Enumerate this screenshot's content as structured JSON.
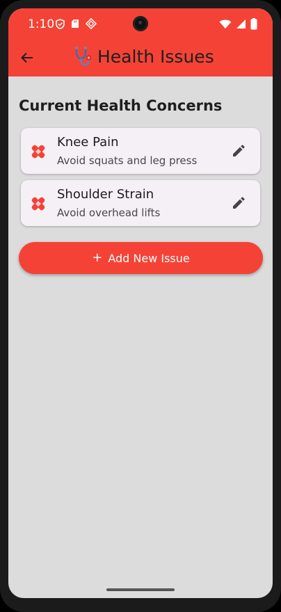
{
  "status_bar": {
    "time": "1:10",
    "left_icons": [
      "shield-icon",
      "sd-card-icon",
      "sim-icon"
    ],
    "right_icons": [
      "wifi-icon",
      "signal-icon",
      "battery-icon"
    ]
  },
  "app_bar": {
    "title": "Health Issues",
    "title_icon": "stethoscope-icon",
    "back_icon": "arrow-back-icon"
  },
  "main": {
    "section_title": "Current Health Concerns",
    "issues": [
      {
        "title": "Knee Pain",
        "subtitle": "Avoid squats and leg press",
        "icon": "bandage-icon",
        "action_icon": "edit-icon"
      },
      {
        "title": "Shoulder Strain",
        "subtitle": "Avoid overhead lifts",
        "icon": "bandage-icon",
        "action_icon": "edit-icon"
      }
    ],
    "add_button_label": "Add New Issue",
    "add_button_icon": "plus-icon"
  },
  "colors": {
    "primary": "#f44336",
    "background": "#dcdcdc",
    "card": "#f5f0f6"
  }
}
